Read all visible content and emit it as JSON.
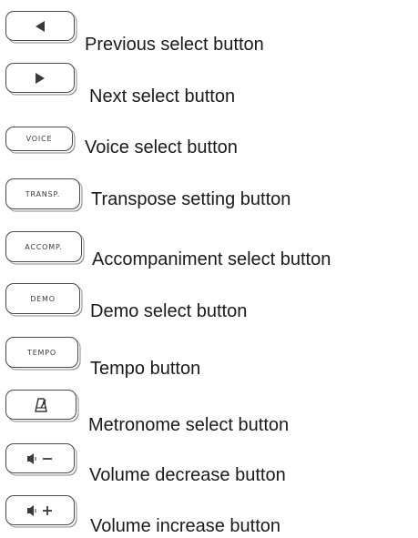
{
  "items": [
    {
      "icon": "triangle-left-icon",
      "button_text": "",
      "label": "Previous select button"
    },
    {
      "icon": "triangle-right-icon",
      "button_text": "",
      "label": "Next select button"
    },
    {
      "icon": "text",
      "button_text": "VOICE",
      "label": "Voice select button"
    },
    {
      "icon": "text",
      "button_text": "TRANSP.",
      "label": "Transpose setting button"
    },
    {
      "icon": "text",
      "button_text": "ACCOMP.",
      "label": "Accompaniment select button"
    },
    {
      "icon": "text",
      "button_text": "DEMO",
      "label": "Demo select button"
    },
    {
      "icon": "text",
      "button_text": "TEMPO",
      "label": "Tempo button"
    },
    {
      "icon": "metronome-icon",
      "button_text": "",
      "label": "Metronome select button"
    },
    {
      "icon": "volume-minus-icon",
      "button_text": "",
      "label": "Volume decrease button"
    },
    {
      "icon": "volume-plus-icon",
      "button_text": "",
      "label": "Volume increase button"
    }
  ]
}
